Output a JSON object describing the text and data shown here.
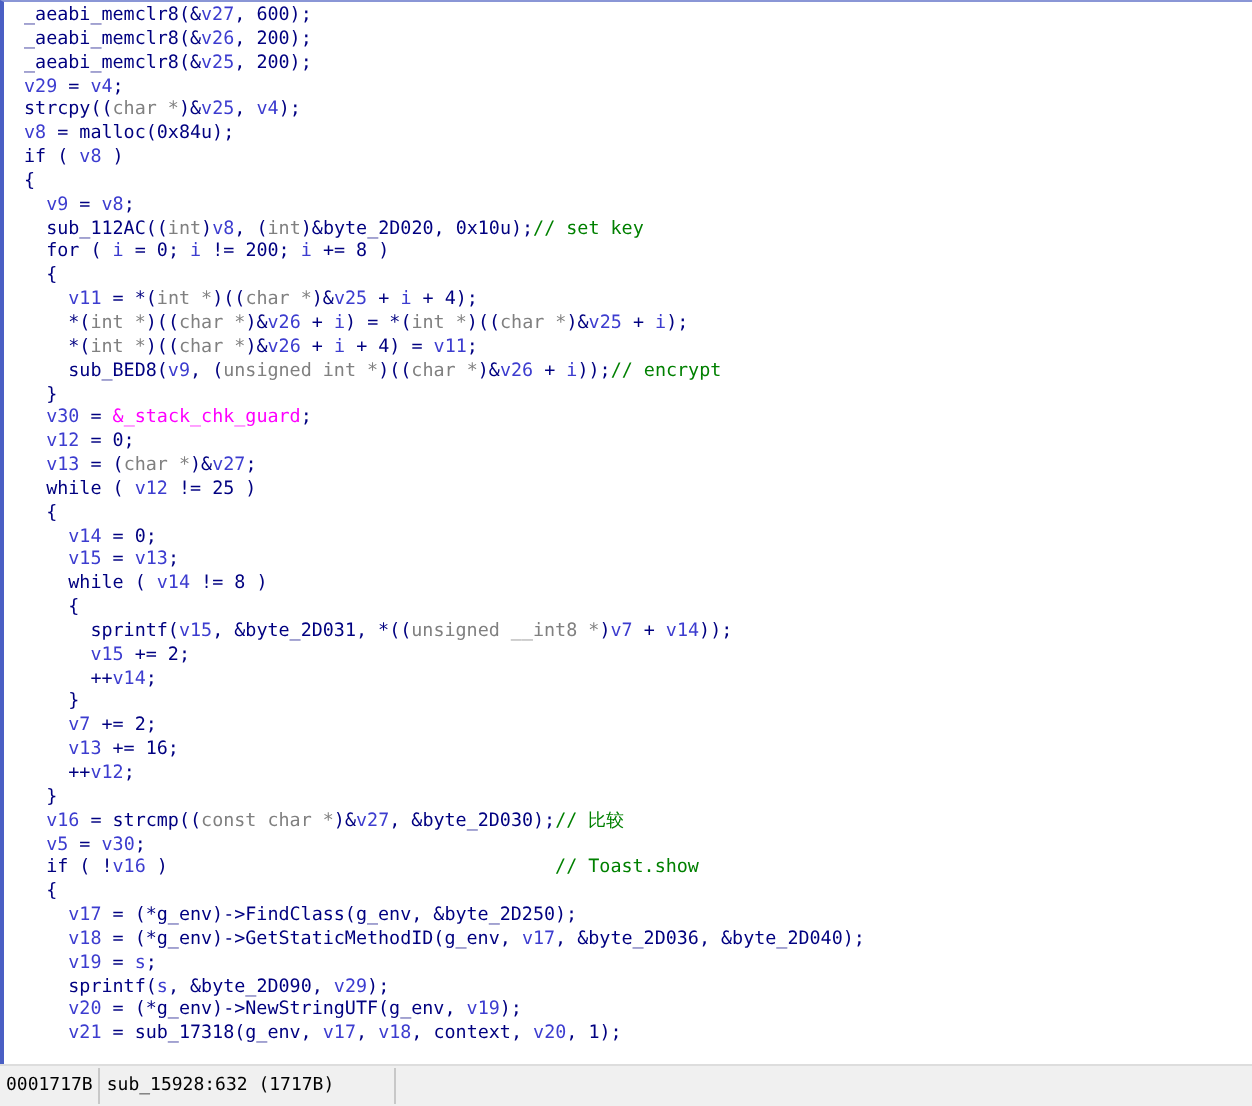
{
  "code_lines": [
    [
      {
        "kind": "code",
        "text": "_aeabi_memclr8(&"
      },
      {
        "kind": "var",
        "text": "v27"
      },
      {
        "kind": "code",
        "text": ", 600);"
      }
    ],
    [
      {
        "kind": "code",
        "text": "_aeabi_memclr8(&"
      },
      {
        "kind": "var",
        "text": "v26"
      },
      {
        "kind": "code",
        "text": ", 200);"
      }
    ],
    [
      {
        "kind": "code",
        "text": "_aeabi_memclr8(&"
      },
      {
        "kind": "var",
        "text": "v25"
      },
      {
        "kind": "code",
        "text": ", 200);"
      }
    ],
    [
      {
        "kind": "var",
        "text": "v29"
      },
      {
        "kind": "code",
        "text": " = "
      },
      {
        "kind": "var",
        "text": "v4"
      },
      {
        "kind": "code",
        "text": ";"
      }
    ],
    [
      {
        "kind": "code",
        "text": "strcpy(("
      },
      {
        "kind": "type",
        "text": "char *"
      },
      {
        "kind": "code",
        "text": ")&"
      },
      {
        "kind": "var",
        "text": "v25"
      },
      {
        "kind": "code",
        "text": ", "
      },
      {
        "kind": "var",
        "text": "v4"
      },
      {
        "kind": "code",
        "text": ");"
      }
    ],
    [
      {
        "kind": "var",
        "text": "v8"
      },
      {
        "kind": "code",
        "text": " = malloc(0x84u);"
      }
    ],
    [
      {
        "kind": "code",
        "text": "if ( "
      },
      {
        "kind": "var",
        "text": "v8"
      },
      {
        "kind": "code",
        "text": " )"
      }
    ],
    [
      {
        "kind": "code",
        "text": "{"
      }
    ],
    [
      {
        "kind": "var",
        "text": "  v9"
      },
      {
        "kind": "code",
        "text": " = "
      },
      {
        "kind": "var",
        "text": "v8"
      },
      {
        "kind": "code",
        "text": ";"
      }
    ],
    [
      {
        "kind": "code",
        "text": "  sub_112AC(("
      },
      {
        "kind": "type",
        "text": "int"
      },
      {
        "kind": "code",
        "text": ")"
      },
      {
        "kind": "var",
        "text": "v8"
      },
      {
        "kind": "code",
        "text": ", ("
      },
      {
        "kind": "type",
        "text": "int"
      },
      {
        "kind": "code",
        "text": ")&byte_2D020, 0x10u);"
      },
      {
        "kind": "comment",
        "text": "// set key"
      }
    ],
    [
      {
        "kind": "code",
        "text": "  for ( "
      },
      {
        "kind": "var",
        "text": "i"
      },
      {
        "kind": "code",
        "text": " = 0; "
      },
      {
        "kind": "var",
        "text": "i"
      },
      {
        "kind": "code",
        "text": " != 200; "
      },
      {
        "kind": "var",
        "text": "i"
      },
      {
        "kind": "code",
        "text": " += 8 )"
      }
    ],
    [
      {
        "kind": "code",
        "text": "  {"
      }
    ],
    [
      {
        "kind": "var",
        "text": "    v11"
      },
      {
        "kind": "code",
        "text": " = *("
      },
      {
        "kind": "type",
        "text": "int *"
      },
      {
        "kind": "code",
        "text": ")(("
      },
      {
        "kind": "type",
        "text": "char *"
      },
      {
        "kind": "code",
        "text": ")&"
      },
      {
        "kind": "var",
        "text": "v25"
      },
      {
        "kind": "code",
        "text": " + "
      },
      {
        "kind": "var",
        "text": "i"
      },
      {
        "kind": "code",
        "text": " + 4);"
      }
    ],
    [
      {
        "kind": "code",
        "text": "    *("
      },
      {
        "kind": "type",
        "text": "int *"
      },
      {
        "kind": "code",
        "text": ")(("
      },
      {
        "kind": "type",
        "text": "char *"
      },
      {
        "kind": "code",
        "text": ")&"
      },
      {
        "kind": "var",
        "text": "v26"
      },
      {
        "kind": "code",
        "text": " + "
      },
      {
        "kind": "var",
        "text": "i"
      },
      {
        "kind": "code",
        "text": ") = *("
      },
      {
        "kind": "type",
        "text": "int *"
      },
      {
        "kind": "code",
        "text": ")(("
      },
      {
        "kind": "type",
        "text": "char *"
      },
      {
        "kind": "code",
        "text": ")&"
      },
      {
        "kind": "var",
        "text": "v25"
      },
      {
        "kind": "code",
        "text": " + "
      },
      {
        "kind": "var",
        "text": "i"
      },
      {
        "kind": "code",
        "text": ");"
      }
    ],
    [
      {
        "kind": "code",
        "text": "    *("
      },
      {
        "kind": "type",
        "text": "int *"
      },
      {
        "kind": "code",
        "text": ")(("
      },
      {
        "kind": "type",
        "text": "char *"
      },
      {
        "kind": "code",
        "text": ")&"
      },
      {
        "kind": "var",
        "text": "v26"
      },
      {
        "kind": "code",
        "text": " + "
      },
      {
        "kind": "var",
        "text": "i"
      },
      {
        "kind": "code",
        "text": " + 4) = "
      },
      {
        "kind": "var",
        "text": "v11"
      },
      {
        "kind": "code",
        "text": ";"
      }
    ],
    [
      {
        "kind": "code",
        "text": "    sub_BED8("
      },
      {
        "kind": "var",
        "text": "v9"
      },
      {
        "kind": "code",
        "text": ", ("
      },
      {
        "kind": "type",
        "text": "unsigned int *"
      },
      {
        "kind": "code",
        "text": ")(("
      },
      {
        "kind": "type",
        "text": "char *"
      },
      {
        "kind": "code",
        "text": ")&"
      },
      {
        "kind": "var",
        "text": "v26"
      },
      {
        "kind": "code",
        "text": " + "
      },
      {
        "kind": "var",
        "text": "i"
      },
      {
        "kind": "code",
        "text": "));"
      },
      {
        "kind": "comment",
        "text": "// encrypt"
      }
    ],
    [
      {
        "kind": "code",
        "text": "  }"
      }
    ],
    [
      {
        "kind": "var",
        "text": "  v30"
      },
      {
        "kind": "code",
        "text": " = "
      },
      {
        "kind": "global",
        "text": "&_stack_chk_guard"
      },
      {
        "kind": "code",
        "text": ";"
      }
    ],
    [
      {
        "kind": "var",
        "text": "  v12"
      },
      {
        "kind": "code",
        "text": " = 0;"
      }
    ],
    [
      {
        "kind": "var",
        "text": "  v13"
      },
      {
        "kind": "code",
        "text": " = ("
      },
      {
        "kind": "type",
        "text": "char *"
      },
      {
        "kind": "code",
        "text": ")&"
      },
      {
        "kind": "var",
        "text": "v27"
      },
      {
        "kind": "code",
        "text": ";"
      }
    ],
    [
      {
        "kind": "code",
        "text": "  while ( "
      },
      {
        "kind": "var",
        "text": "v12"
      },
      {
        "kind": "code",
        "text": " != 25 )"
      }
    ],
    [
      {
        "kind": "code",
        "text": "  {"
      }
    ],
    [
      {
        "kind": "var",
        "text": "    v14"
      },
      {
        "kind": "code",
        "text": " = 0;"
      }
    ],
    [
      {
        "kind": "var",
        "text": "    v15"
      },
      {
        "kind": "code",
        "text": " = "
      },
      {
        "kind": "var",
        "text": "v13"
      },
      {
        "kind": "code",
        "text": ";"
      }
    ],
    [
      {
        "kind": "code",
        "text": "    while ( "
      },
      {
        "kind": "var",
        "text": "v14"
      },
      {
        "kind": "code",
        "text": " != 8 )"
      }
    ],
    [
      {
        "kind": "code",
        "text": "    {"
      }
    ],
    [
      {
        "kind": "code",
        "text": "      sprintf("
      },
      {
        "kind": "var",
        "text": "v15"
      },
      {
        "kind": "code",
        "text": ", &byte_2D031, *(("
      },
      {
        "kind": "type",
        "text": "unsigned __int8 *"
      },
      {
        "kind": "code",
        "text": ")"
      },
      {
        "kind": "var",
        "text": "v7"
      },
      {
        "kind": "code",
        "text": " + "
      },
      {
        "kind": "var",
        "text": "v14"
      },
      {
        "kind": "code",
        "text": "));"
      }
    ],
    [
      {
        "kind": "var",
        "text": "      v15"
      },
      {
        "kind": "code",
        "text": " += 2;"
      }
    ],
    [
      {
        "kind": "code",
        "text": "      ++"
      },
      {
        "kind": "var",
        "text": "v14"
      },
      {
        "kind": "code",
        "text": ";"
      }
    ],
    [
      {
        "kind": "code",
        "text": "    }"
      }
    ],
    [
      {
        "kind": "var",
        "text": "    v7"
      },
      {
        "kind": "code",
        "text": " += 2;"
      }
    ],
    [
      {
        "kind": "var",
        "text": "    v13"
      },
      {
        "kind": "code",
        "text": " += 16;"
      }
    ],
    [
      {
        "kind": "code",
        "text": "    ++"
      },
      {
        "kind": "var",
        "text": "v12"
      },
      {
        "kind": "code",
        "text": ";"
      }
    ],
    [
      {
        "kind": "code",
        "text": "  }"
      }
    ],
    [
      {
        "kind": "var",
        "text": "  v16"
      },
      {
        "kind": "code",
        "text": " = strcmp(("
      },
      {
        "kind": "type",
        "text": "const char *"
      },
      {
        "kind": "code",
        "text": ")&"
      },
      {
        "kind": "var",
        "text": "v27"
      },
      {
        "kind": "code",
        "text": ", &byte_2D030);"
      },
      {
        "kind": "comment",
        "text": "// 比较"
      }
    ],
    [
      {
        "kind": "var",
        "text": "  v5"
      },
      {
        "kind": "code",
        "text": " = "
      },
      {
        "kind": "var",
        "text": "v30"
      },
      {
        "kind": "code",
        "text": ";"
      }
    ],
    [
      {
        "kind": "code",
        "text": "  if ( !"
      },
      {
        "kind": "var",
        "text": "v16"
      },
      {
        "kind": "code",
        "text": " )"
      },
      {
        "kind": "comment",
        "text": "                                   // Toast.show"
      }
    ],
    [
      {
        "kind": "code",
        "text": "  {"
      }
    ],
    [
      {
        "kind": "var",
        "text": "    v17"
      },
      {
        "kind": "code",
        "text": " = (*g_env)->FindClass(g_env, &byte_2D250);"
      }
    ],
    [
      {
        "kind": "var",
        "text": "    v18"
      },
      {
        "kind": "code",
        "text": " = (*g_env)->GetStaticMethodID(g_env, "
      },
      {
        "kind": "var",
        "text": "v17"
      },
      {
        "kind": "code",
        "text": ", &byte_2D036, &byte_2D040);"
      }
    ],
    [
      {
        "kind": "var",
        "text": "    v19"
      },
      {
        "kind": "code",
        "text": " = "
      },
      {
        "kind": "var",
        "text": "s"
      },
      {
        "kind": "code",
        "text": ";"
      }
    ],
    [
      {
        "kind": "code",
        "text": "    sprintf("
      },
      {
        "kind": "var",
        "text": "s"
      },
      {
        "kind": "code",
        "text": ", &byte_2D090, "
      },
      {
        "kind": "var",
        "text": "v29"
      },
      {
        "kind": "code",
        "text": ");"
      }
    ],
    [
      {
        "kind": "var",
        "text": "    v20"
      },
      {
        "kind": "code",
        "text": " = (*g_env)->NewStringUTF(g_env, "
      },
      {
        "kind": "var",
        "text": "v19"
      },
      {
        "kind": "code",
        "text": ");"
      }
    ],
    [
      {
        "kind": "var",
        "text": "    v21"
      },
      {
        "kind": "code",
        "text": " = sub_17318(g_env, "
      },
      {
        "kind": "var",
        "text": "v17"
      },
      {
        "kind": "code",
        "text": ", "
      },
      {
        "kind": "var",
        "text": "v18"
      },
      {
        "kind": "code",
        "text": ", context, "
      },
      {
        "kind": "var",
        "text": "v20"
      },
      {
        "kind": "code",
        "text": ", 1);"
      }
    ]
  ],
  "status_bar": {
    "address": "0001717B",
    "location": "sub_15928:632 (1717B)"
  }
}
